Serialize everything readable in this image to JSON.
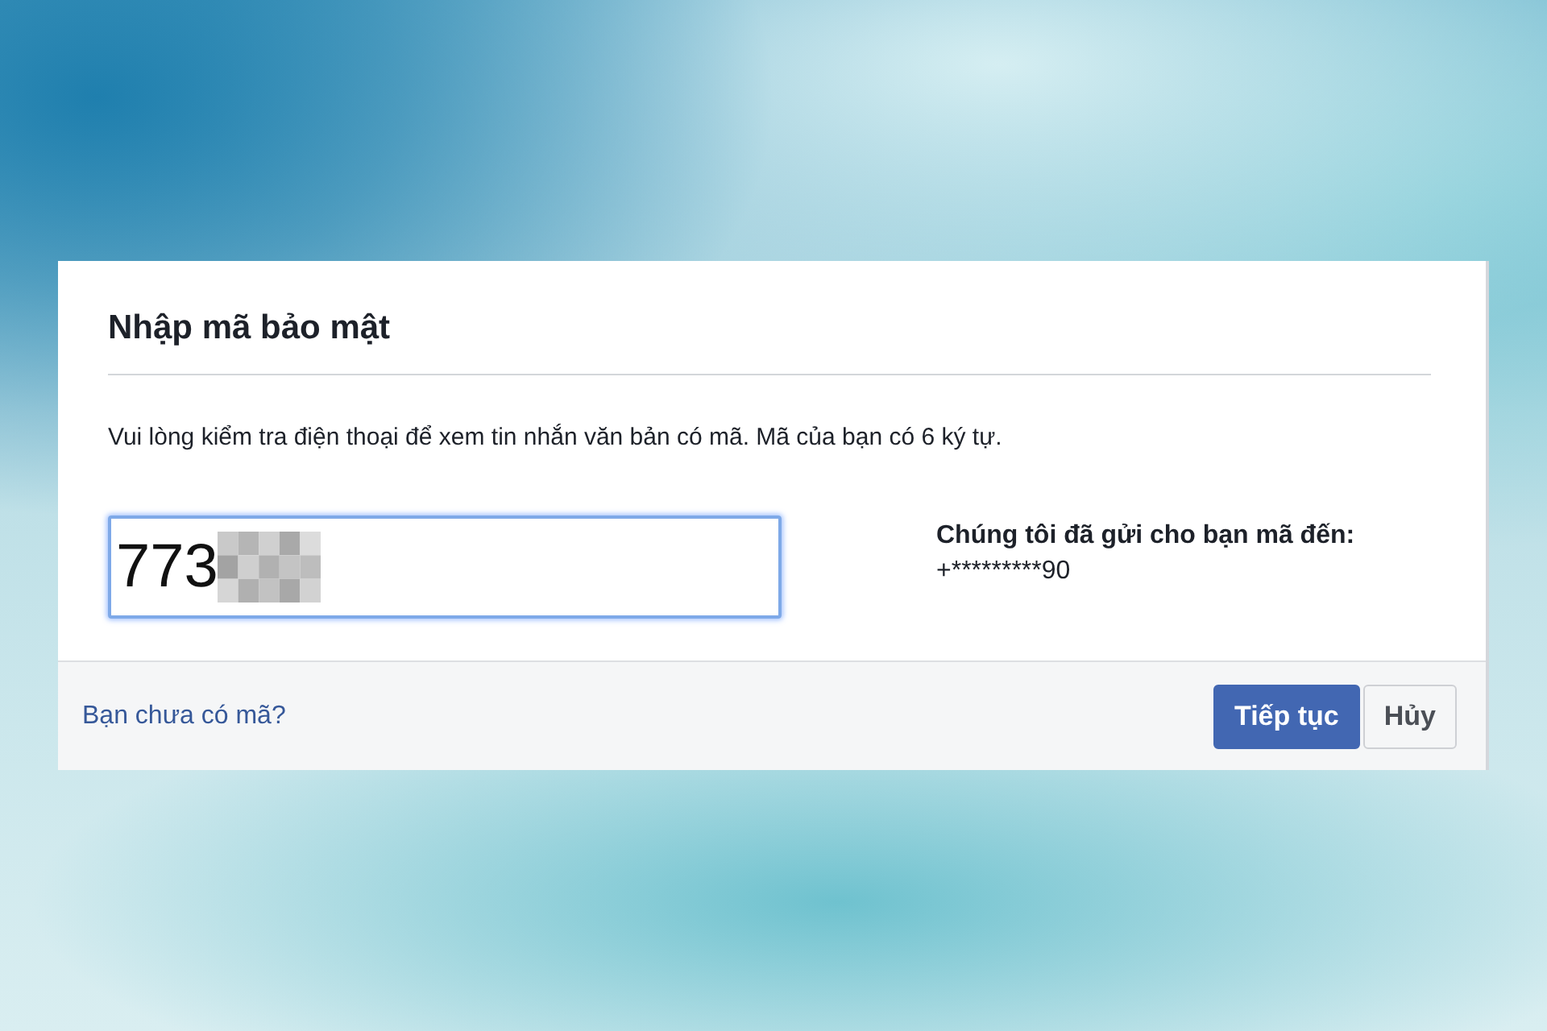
{
  "dialog": {
    "title": "Nhập mã bảo mật",
    "instructions": "Vui lòng kiểm tra điện thoại để xem tin nhắn văn bản có mã. Mã của bạn có 6 ký tự.",
    "code_field": {
      "value": "773",
      "focused": true
    },
    "sent_to": {
      "label": "Chúng tôi đã gửi cho bạn mã đến:",
      "number": "+*********90"
    }
  },
  "footer": {
    "link": "Bạn chưa có mã?",
    "buttons": [
      {
        "label": "Tiếp tục",
        "kind": "primary"
      },
      {
        "label": "Hủy",
        "kind": "secondary"
      }
    ]
  }
}
